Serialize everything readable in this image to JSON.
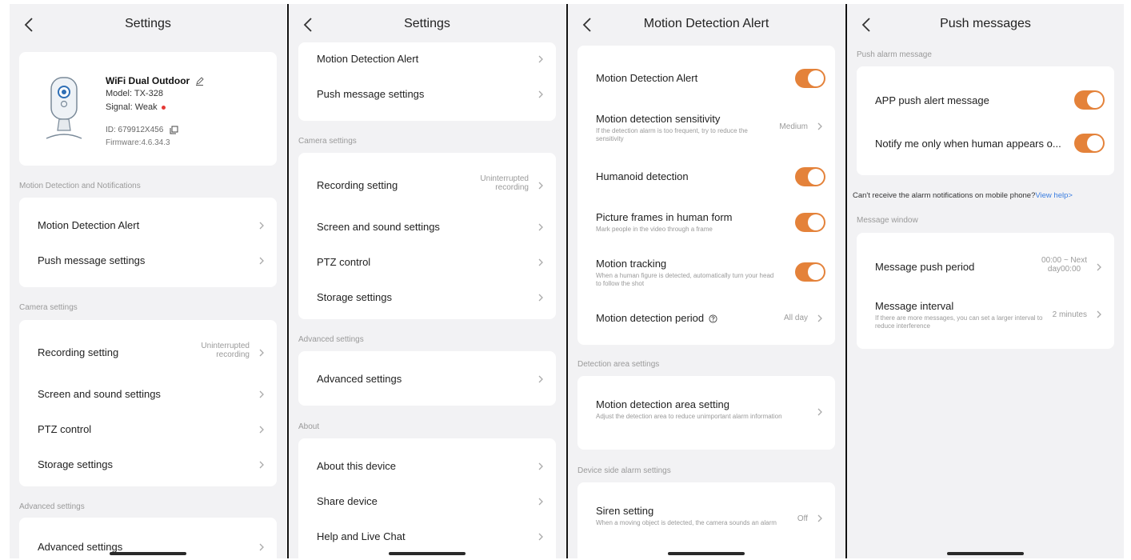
{
  "panel1": {
    "title": "Settings",
    "device": {
      "name": "WiFi Dual Outdoor",
      "model": "Model: TX-328",
      "signal_label": "Signal: ",
      "signal_value": "Weak",
      "id": "ID: 679912X456",
      "firmware": "Firmware:4.6.34.3"
    },
    "section_motion": "Motion Detection and Notifications",
    "motion_alert": "Motion Detection Alert",
    "push_settings": "Push message settings",
    "section_camera": "Camera settings",
    "recording": "Recording setting",
    "recording_value_1": "Uninterrupted",
    "recording_value_2": "recording",
    "screen_sound": "Screen and sound settings",
    "ptz": "PTZ control",
    "storage": "Storage settings",
    "section_advanced": "Advanced settings",
    "advanced": "Advanced settings"
  },
  "panel2": {
    "title": "Settings",
    "motion_alert": "Motion Detection Alert",
    "push_settings": "Push message settings",
    "section_camera": "Camera settings",
    "recording": "Recording setting",
    "recording_value_1": "Uninterrupted",
    "recording_value_2": "recording",
    "screen_sound": "Screen and sound settings",
    "ptz": "PTZ control",
    "storage": "Storage settings",
    "section_advanced": "Advanced settings",
    "advanced": "Advanced settings",
    "section_about": "About",
    "about_device": "About this device",
    "share": "Share device",
    "help": "Help and Live Chat"
  },
  "panel3": {
    "title": "Motion Detection Alert",
    "motion_alert": "Motion Detection Alert",
    "sensitivity": "Motion detection sensitivity",
    "sensitivity_desc": "If the detection alarm is too frequent, try to reduce the sensitivity",
    "sensitivity_value": "Medium",
    "humanoid": "Humanoid detection",
    "frames": "Picture frames in human form",
    "frames_desc": "Mark people in the video through a frame",
    "tracking": "Motion tracking",
    "tracking_desc": "When a human figure is detected, automatically turn your head to follow the shot",
    "period": "Motion detection period",
    "period_value": "All day",
    "section_area": "Detection area settings",
    "area": "Motion detection area setting",
    "area_desc": "Adjust the detection area to reduce unimportant alarm information",
    "section_device": "Device side alarm settings",
    "siren": "Siren setting",
    "siren_desc": "When a moving object is detected, the camera sounds an alarm",
    "siren_value": "Off"
  },
  "panel4": {
    "title": "Push messages",
    "section_push": "Push alarm message",
    "app_push": "APP push alert message",
    "notify_human": "Notify me only when human appears o...",
    "help_text": "Can't receive the alarm notifications on mobile phone?",
    "help_link": "View help>",
    "section_window": "Message window",
    "push_period": "Message push period",
    "push_period_value_1": "00:00 ~ Next",
    "push_period_value_2": "day00:00",
    "interval": "Message interval",
    "interval_desc": "If there are more messages, you can set a larger interval to reduce interference",
    "interval_value": "2 minutes"
  },
  "colors": {
    "toggle_on": "#e4823a",
    "link": "#3a7de0",
    "signal_dot": "#e53935",
    "background": "#f2f2f4"
  },
  "toggles": {
    "motion_alert": true,
    "humanoid": true,
    "frames": true,
    "tracking": true,
    "app_push": true,
    "notify_human": true
  }
}
